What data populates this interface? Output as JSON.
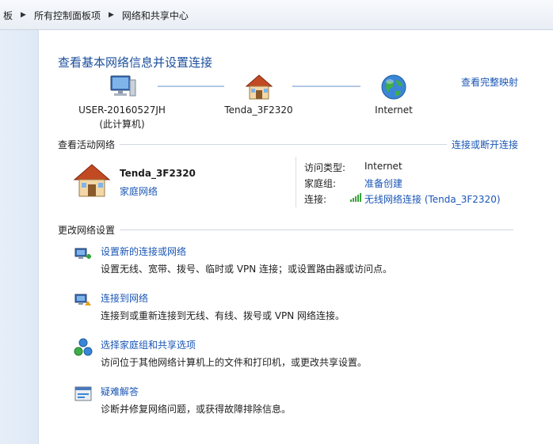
{
  "breadcrumb": {
    "items": [
      "板",
      "所有控制面板项",
      "网络和共享中心"
    ]
  },
  "main": {
    "title": "查看基本网络信息并设置连接",
    "full_map_link": "查看完整映射",
    "network_map": {
      "computer": {
        "name": "USER-20160527JH",
        "note": "(此计算机)"
      },
      "router": {
        "name": "Tenda_3F2320"
      },
      "internet": {
        "name": "Internet"
      }
    },
    "active_networks": {
      "header": "查看活动网络",
      "connect_link": "连接或断开连接",
      "network": {
        "name": "Tenda_3F2320",
        "type_link": "家庭网络",
        "access_type_label": "访问类型:",
        "access_type_value": "Internet",
        "homegroup_label": "家庭组:",
        "homegroup_value": "准备创建",
        "connection_label": "连接:",
        "connection_value": "无线网络连接 (Tenda_3F2320)"
      }
    },
    "change_settings": {
      "header": "更改网络设置",
      "tasks": [
        {
          "link": "设置新的连接或网络",
          "desc": "设置无线、宽带、拨号、临时或 VPN 连接；或设置路由器或访问点。",
          "icon": "new-connection-icon"
        },
        {
          "link": "连接到网络",
          "desc": "连接到或重新连接到无线、有线、拨号或 VPN 网络连接。",
          "icon": "connect-network-icon"
        },
        {
          "link": "选择家庭组和共享选项",
          "desc": "访问位于其他网络计算机上的文件和打印机，或更改共享设置。",
          "icon": "homegroup-icon"
        },
        {
          "link": "疑难解答",
          "desc": "诊断并修复网络问题，或获得故障排除信息。",
          "icon": "troubleshoot-icon"
        }
      ]
    }
  },
  "colors": {
    "link": "#1a56b5",
    "title": "#1b4f9c",
    "signal": "#3aa23a"
  }
}
